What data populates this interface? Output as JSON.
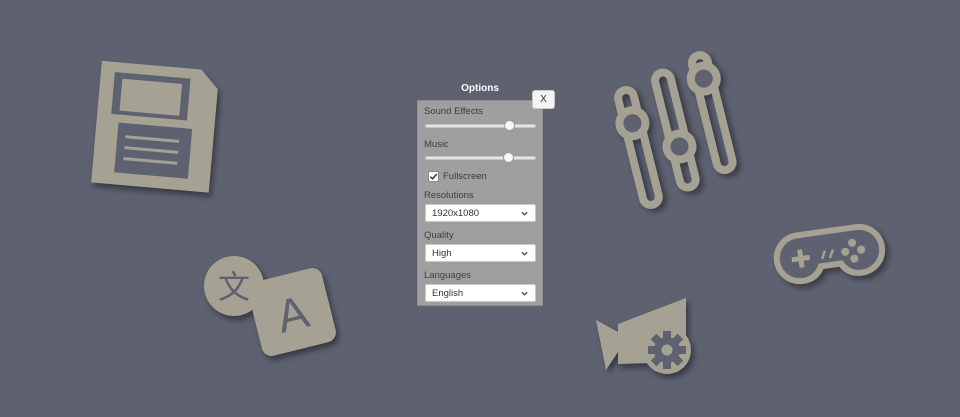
{
  "background_color": "#5d6170",
  "icon_color": "#a6a293",
  "options": {
    "title": "Options",
    "close_label": "X",
    "sound_effects": {
      "label": "Sound Effects",
      "value": 0.79
    },
    "music": {
      "label": "Music",
      "value": 0.78
    },
    "fullscreen": {
      "label": "Fullscreen",
      "checked": true
    },
    "resolutions": {
      "label": "Resolutions",
      "selected": "1920x1080"
    },
    "quality": {
      "label": "Quality",
      "selected": "High"
    },
    "languages": {
      "label": "Languages",
      "selected": "English"
    }
  },
  "decorations": [
    "floppy-disk-icon",
    "translate-icon",
    "equalizer-sliders-icon",
    "gamepad-icon",
    "video-camera-gear-icon"
  ]
}
